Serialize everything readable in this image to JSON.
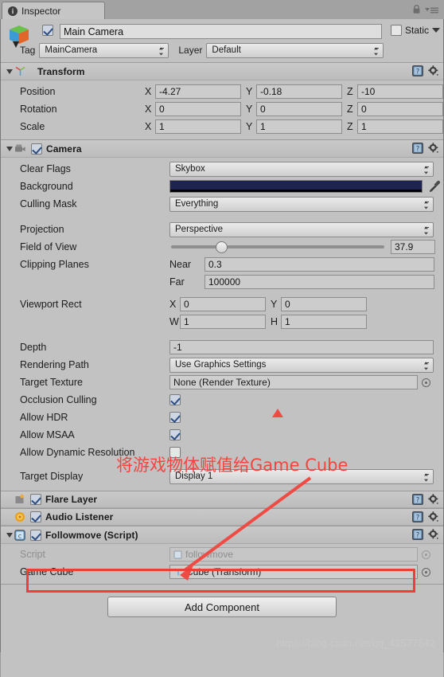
{
  "window": {
    "tab_label": "Inspector",
    "tab_icon": "info-icon",
    "lock_icon": "lock-icon",
    "menu_icon": "hamburger-menu-icon"
  },
  "object_header": {
    "icon": "prefab-cube-icon",
    "enabled": true,
    "name": "Main Camera",
    "static_label": "Static",
    "static_checked": false,
    "tag_label": "Tag",
    "tag_value": "MainCamera",
    "layer_label": "Layer",
    "layer_value": "Default"
  },
  "components": [
    {
      "name": "Transform",
      "icon": "transform-axis-icon",
      "expanded": true,
      "has_checkbox": false,
      "rows": [
        {
          "label": "Position",
          "type": "vector3",
          "x": "-4.27",
          "y": "-0.18",
          "z": "-10"
        },
        {
          "label": "Rotation",
          "type": "vector3",
          "x": "0",
          "y": "0",
          "z": "0"
        },
        {
          "label": "Scale",
          "type": "vector3",
          "x": "1",
          "y": "1",
          "z": "1"
        }
      ]
    },
    {
      "name": "Camera",
      "icon": "camera-icon",
      "expanded": true,
      "has_checkbox": true,
      "checked": true,
      "rows": [
        {
          "label": "Clear Flags",
          "type": "dropdown",
          "value": "Skybox"
        },
        {
          "label": "Background",
          "type": "color",
          "value": "#1e2350"
        },
        {
          "label": "Culling Mask",
          "type": "dropdown",
          "value": "Everything"
        },
        {
          "label": "Projection",
          "type": "dropdown",
          "value": "Perspective"
        },
        {
          "label": "Field of View",
          "type": "slider",
          "value": "37.9",
          "slider_pct": 22
        },
        {
          "label": "Clipping Planes",
          "type": "pair_near",
          "sub_label": "Near",
          "value": "0.3"
        },
        {
          "label": "",
          "type": "pair_far",
          "sub_label": "Far",
          "value": "100000"
        },
        {
          "label": "Viewport Rect",
          "type": "vector2",
          "a_axis": "X",
          "a": "0",
          "b_axis": "Y",
          "b": "0"
        },
        {
          "label": "",
          "type": "vector2",
          "a_axis": "W",
          "a": "1",
          "b_axis": "H",
          "b": "1"
        },
        {
          "label": "Depth",
          "type": "text",
          "value": "-1"
        },
        {
          "label": "Rendering Path",
          "type": "dropdown",
          "value": "Use Graphics Settings"
        },
        {
          "label": "Target Texture",
          "type": "object",
          "value": "None (Render Texture)"
        },
        {
          "label": "Occlusion Culling",
          "type": "checkbox",
          "checked": true
        },
        {
          "label": "Allow HDR",
          "type": "checkbox",
          "checked": true
        },
        {
          "label": "Allow MSAA",
          "type": "checkbox",
          "checked": true
        },
        {
          "label": "Allow Dynamic Resolution",
          "type": "checkbox",
          "checked": false
        },
        {
          "label": "Target Display",
          "type": "dropdown",
          "value": "Display 1"
        }
      ]
    },
    {
      "name": "Flare Layer",
      "icon": "flare-layer-icon",
      "expanded": false,
      "has_checkbox": true,
      "checked": true,
      "rows": []
    },
    {
      "name": "Audio Listener",
      "icon": "audio-listener-icon",
      "expanded": false,
      "has_checkbox": true,
      "checked": true,
      "rows": []
    },
    {
      "name": "Followmove (Script)",
      "icon": "csharp-script-icon",
      "expanded": true,
      "has_checkbox": true,
      "checked": true,
      "rows": [
        {
          "label": "Script",
          "type": "object_disabled",
          "value": "followmove"
        },
        {
          "label": "Game Cube",
          "type": "object_transform",
          "value": "Cube (Transform)"
        }
      ]
    }
  ],
  "add_component_label": "Add Component",
  "watermark": "https://blog.csdn.net/qq_42577542",
  "annotations": {
    "note_text": "将游戏物体赋值给Game Cube",
    "note_color": "#f3453f",
    "highlight_color": "#ef3d3a"
  }
}
